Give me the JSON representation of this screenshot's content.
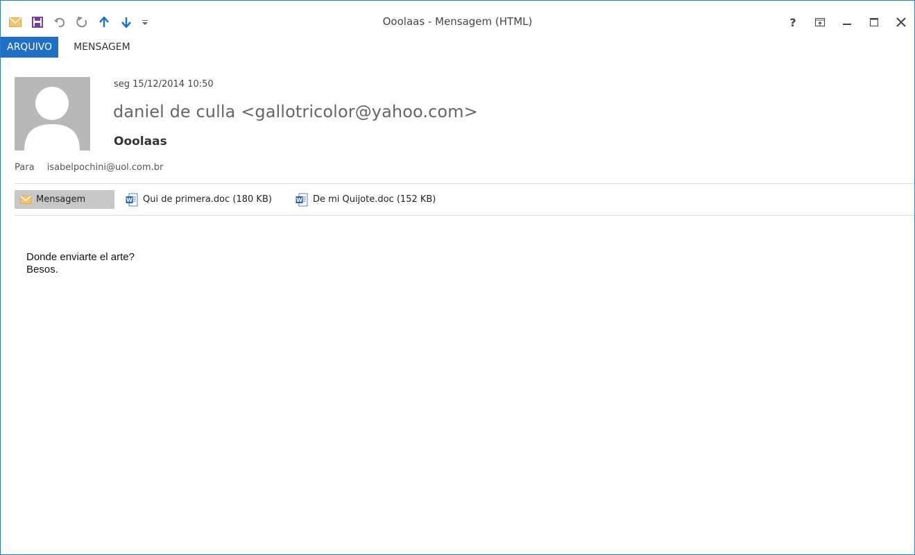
{
  "window": {
    "title": "Ooolaas - Mensagem (HTML)"
  },
  "quick_access": {
    "icons": [
      "envelope-icon",
      "save-icon",
      "undo-icon",
      "redo-icon",
      "arrow-up-icon",
      "arrow-down-icon",
      "customize-icon"
    ]
  },
  "window_controls": {
    "icons": [
      "help-icon",
      "ribbon-display-icon",
      "minimize-icon",
      "maximize-icon",
      "close-icon"
    ]
  },
  "ribbon": {
    "tabs": [
      {
        "label": "ARQUIVO"
      },
      {
        "label": "MENSAGEM"
      }
    ]
  },
  "header": {
    "date": "seg 15/12/2014 10:50",
    "sender": "daniel de culla <gallotricolor@yahoo.com>",
    "subject": "Ooolaas",
    "to_label": "Para",
    "to_address": "isabelpochini@uol.com.br"
  },
  "attachments": [
    {
      "label": "Mensagem",
      "icon": "envelope-icon"
    },
    {
      "label": "Qui de primera.doc (180 KB)",
      "icon": "word-doc-icon"
    },
    {
      "label": "De mi Quijote.doc (152 KB)",
      "icon": "word-doc-icon"
    }
  ],
  "body": {
    "lines": [
      "Donde enviarte el arte?",
      "Besos."
    ]
  },
  "colors": {
    "accent": "#1f6fc5",
    "border": "#2b7bc7",
    "envelope": "#f0c36d",
    "save": "#7a3f9e"
  }
}
